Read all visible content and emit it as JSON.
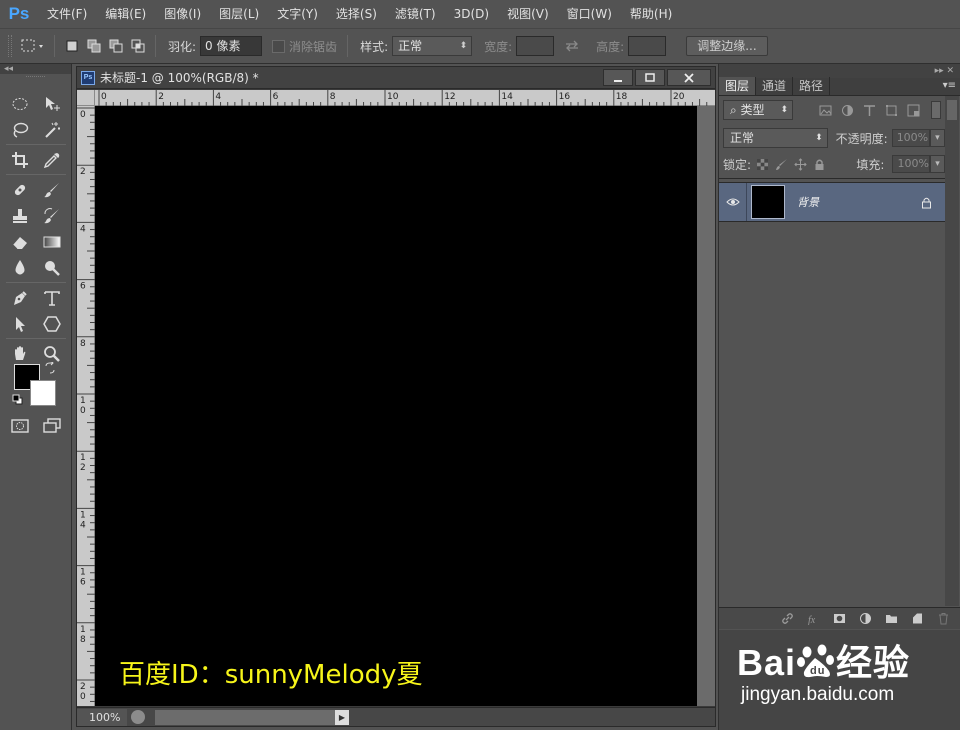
{
  "app": {
    "logo": "Ps"
  },
  "menu": [
    "文件(F)",
    "编辑(E)",
    "图像(I)",
    "图层(L)",
    "文字(Y)",
    "选择(S)",
    "滤镜(T)",
    "3D(D)",
    "视图(V)",
    "窗口(W)",
    "帮助(H)"
  ],
  "options": {
    "feather_label": "羽化:",
    "feather_value": "0 像素",
    "antialias_label": "消除锯齿",
    "style_label": "样式:",
    "style_value": "正常",
    "width_label": "宽度:",
    "height_label": "高度:",
    "refine_edge_label": "调整边缘..."
  },
  "document": {
    "title": "未标题-1 @ 100%(RGB/8) *",
    "ps_icon": "Ps",
    "zoom": "100%",
    "hruler_labels": [
      "0",
      "2",
      "4",
      "6",
      "8",
      "10",
      "12",
      "14",
      "16",
      "18",
      "20"
    ],
    "vruler_labels": [
      "0",
      "2",
      "4",
      "6",
      "8",
      "1\n0",
      "1\n2",
      "1\n4",
      "1\n6",
      "1\n8",
      "2\n0"
    ],
    "watermark": "百度ID：sunnyMelody夏"
  },
  "panel": {
    "tabs": [
      "图层",
      "通道",
      "路径"
    ],
    "kind_filter": "类型",
    "blend_mode": "正常",
    "opacity_label": "不透明度:",
    "opacity_value": "100%",
    "lock_label": "锁定:",
    "fill_label": "填充:",
    "fill_value": "100%",
    "layer_name": "背景"
  },
  "branding": {
    "baidu_text_left": "Bai",
    "baidu_text_right": "经验",
    "baidu_url": "jingyan.baidu.com"
  },
  "colors": {
    "accent_blue": "#4aa7ff",
    "selected_layer": "#596780",
    "watermark_yellow": "#f7f51a"
  }
}
